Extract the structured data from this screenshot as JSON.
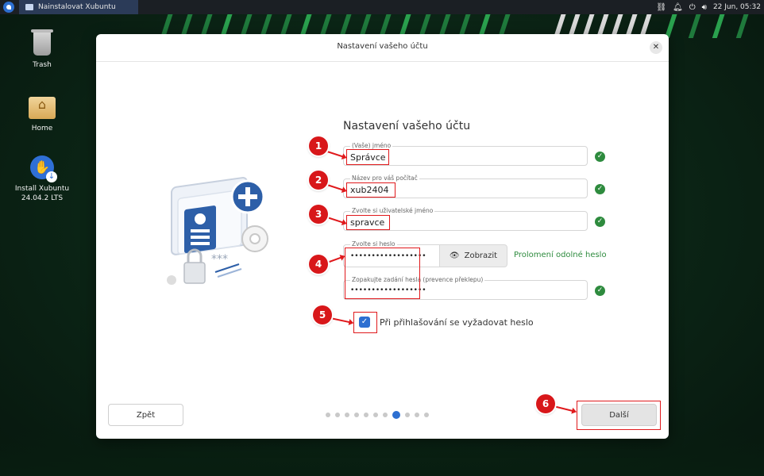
{
  "panel": {
    "task_title": "Nainstalovat Xubuntu",
    "clock": "22 Jun, 05:32"
  },
  "desktop": {
    "icons": [
      {
        "label": "Trash"
      },
      {
        "label": "Home"
      },
      {
        "label": "Install Xubuntu 24.04.2 LTS"
      }
    ]
  },
  "dialog": {
    "title": "Nastavení vašeho účtu",
    "heading": "Nastavení vašeho účtu",
    "fields": {
      "name": {
        "label": "(Vaše) jméno",
        "value": "Správce"
      },
      "computer": {
        "label": "Název pro váš počítač",
        "value": "xub2404"
      },
      "username": {
        "label": "Zvolte si uživatelské jméno",
        "value": "spravce"
      },
      "password": {
        "label": "Zvolte si heslo",
        "value": "••••••••••••••••••"
      },
      "password_confirm": {
        "label": "Zopakujte zadání hesla (prevence překlepu)",
        "value": "••••••••••••••••••"
      }
    },
    "show_button": "Zobrazit",
    "strength_text": "Prolomení odolné heslo",
    "require_password_label": "Při přihlašování se vyžadovat heslo",
    "require_password_checked": true,
    "back_button": "Zpět",
    "next_button": "Další",
    "progress": {
      "total_steps": 11,
      "current_step": 8
    }
  },
  "annotations": [
    "1",
    "2",
    "3",
    "4",
    "5",
    "6"
  ],
  "colors": {
    "accent": "#2d6fd1",
    "ok": "#2e8b3e",
    "annotation": "#e0191c"
  }
}
